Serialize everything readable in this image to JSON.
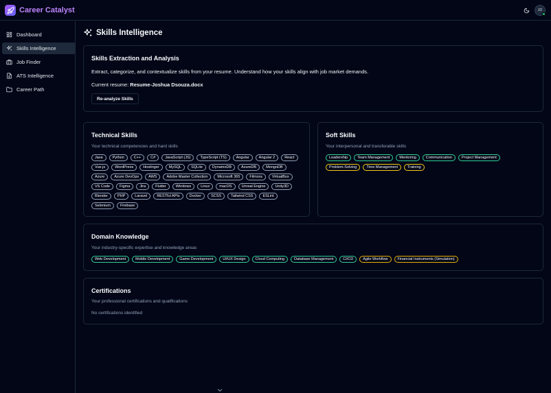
{
  "app": {
    "name": "Career Catalyst",
    "avatar_initials": "JD"
  },
  "colors": {
    "accent": "#c084fc",
    "background": "#020617",
    "border": "#1e293b",
    "online": "#22c55e"
  },
  "sidebar": {
    "items": [
      {
        "label": "Dashboard",
        "icon": "grid-icon",
        "active": false
      },
      {
        "label": "Skills Intelligence",
        "icon": "sparkles-icon",
        "active": true
      },
      {
        "label": "Job Finder",
        "icon": "briefcase-icon",
        "active": false
      },
      {
        "label": "ATS Intelligence",
        "icon": "file-icon",
        "active": false
      },
      {
        "label": "Career Path",
        "icon": "folder-icon",
        "active": false
      }
    ]
  },
  "page": {
    "title": "Skills Intelligence"
  },
  "analysis": {
    "title": "Skills Extraction and Analysis",
    "description": "Extract, categorize, and contextualize skills from your resume. Understand how your skills align with job market demands.",
    "current_label": "Current resume:",
    "current_file": "Resume-Joshua Dsouza.docx",
    "button": "Re-analyze Skills"
  },
  "technical": {
    "title": "Technical Skills",
    "subtitle": "Your technical competencies and hard skills",
    "skills": [
      "Java",
      "Python",
      "C++",
      "C#",
      "JavaScript (JS)",
      "TypeScript (TS)",
      "Angular",
      "Angular 2",
      "React",
      "Vue.js",
      "WordPress",
      "Hostinger",
      "MySQL",
      "SQLite",
      "DynamoDB",
      "AzureDB",
      "MongoDB",
      "Azure",
      "Azure DevOps",
      "AWS",
      "Adobe Master Collection",
      "Microsoft 365",
      "Filmora",
      "VirtualBox",
      "VS Code",
      "Figma",
      "Jira",
      "Flutter",
      "Windows",
      "Linux",
      "macOS",
      "Unreal Engine",
      "Unity3D",
      "Blender",
      "PHP",
      "Laravel",
      "RESTful APIs",
      "Docker",
      "SCSS",
      "Tailwind CSS",
      "ESLint",
      "Selenium",
      "Firebase"
    ]
  },
  "soft": {
    "title": "Soft Skills",
    "subtitle": "Your interpersonal and transferable skills",
    "skills": [
      "Leadership",
      "Team Management",
      "Mentoring",
      "Communication",
      "Project Management",
      "Problem-Solving",
      "Time Management",
      "Training"
    ]
  },
  "domain": {
    "title": "Domain Knowledge",
    "subtitle": "Your industry-specific expertise and knowledge areas",
    "skills": [
      "Web Development",
      "Mobile Development",
      "Game Development",
      "UI/UX Design",
      "Cloud Computing",
      "Database Management",
      "CI/CD",
      "Agile Workflow",
      "Financial Instruments (Simulation)"
    ]
  },
  "certifications": {
    "title": "Certifications",
    "subtitle": "Your professional certifications and qualifications",
    "empty_text": "No certifications identified"
  }
}
